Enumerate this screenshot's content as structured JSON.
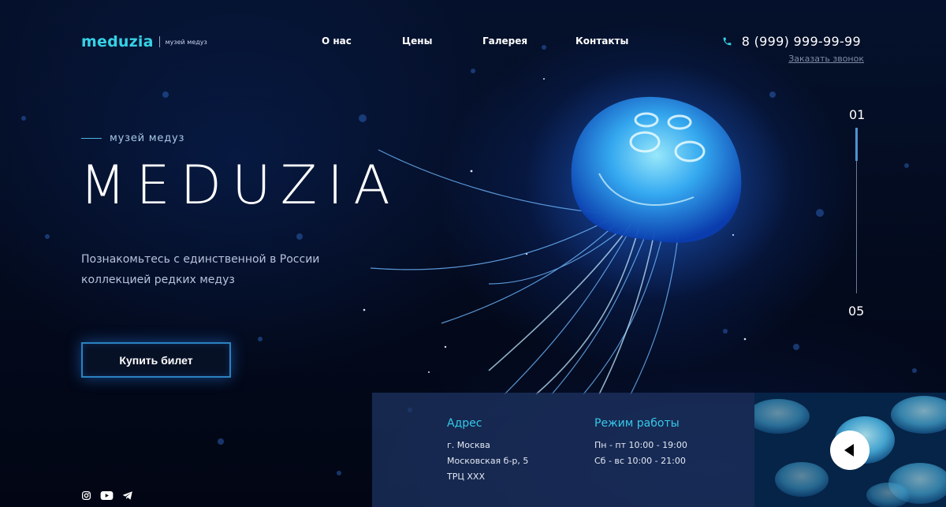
{
  "brand": {
    "name": "meduzia",
    "tagline": "музей медуз"
  },
  "nav": [
    {
      "label": "О нас"
    },
    {
      "label": "Цены"
    },
    {
      "label": "Галерея"
    },
    {
      "label": "Контакты"
    }
  ],
  "contact": {
    "phone": "8 (999) 999-99-99",
    "callback_label": "Заказать звонок"
  },
  "hero": {
    "kicker": "музей медуз",
    "title": "MEDUZIA",
    "description": "Познакомьтесь с единственной в России коллекцией редких медуз",
    "cta_label": "Купить билет"
  },
  "slider": {
    "current": "01",
    "total": "05",
    "progress": 0.2
  },
  "info": {
    "address": {
      "title": "Адрес",
      "lines": [
        "г. Москва",
        "Московская б-р, 5",
        "ТРЦ ХХХ"
      ]
    },
    "hours": {
      "title": "Режим работы",
      "lines": [
        "Пн - пт 10:00 - 19:00",
        "Сб - вс 10:00 - 21:00"
      ]
    }
  },
  "socials": [
    {
      "icon": "instagram-icon"
    },
    {
      "icon": "youtube-icon"
    },
    {
      "icon": "telegram-icon"
    }
  ],
  "colors": {
    "accent": "#36d2e6",
    "button_border": "#2a82c0",
    "background": "#030816",
    "panel": "#1e3464"
  }
}
